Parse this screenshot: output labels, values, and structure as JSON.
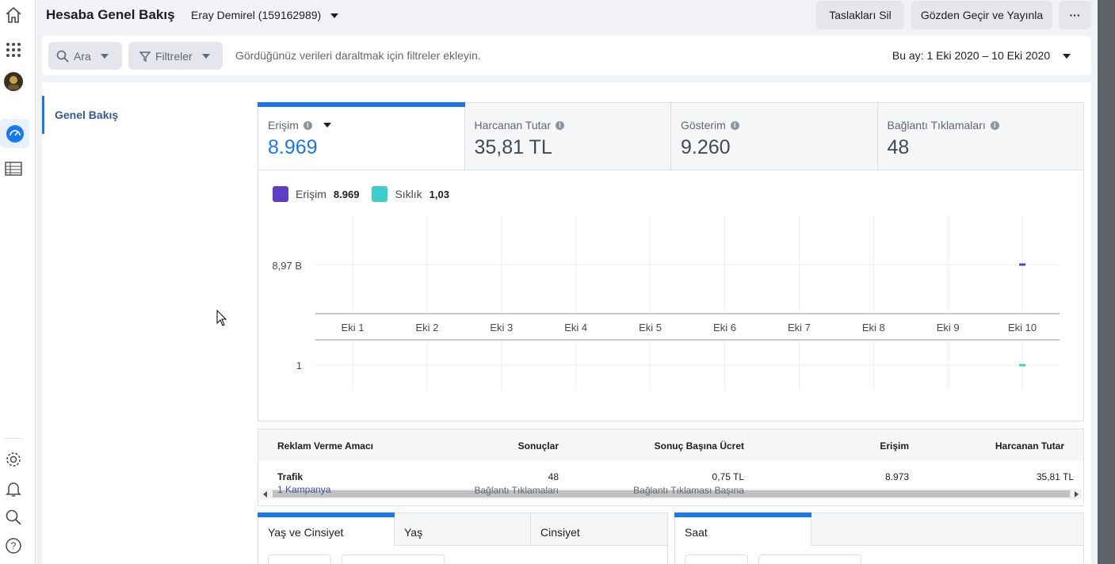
{
  "header": {
    "title": "Hesaba Genel Bakış",
    "account": "Eray Demirel (159162989)",
    "discard_drafts": "Taslakları Sil",
    "review_publish": "Gözden Geçir ve Yayınla",
    "more": "···"
  },
  "filterbar": {
    "search": "Ara",
    "filters": "Filtreler",
    "hint": "Gördüğünüz verileri daraltmak için filtreler ekleyin.",
    "date_range": "Bu ay: 1 Eki 2020 – 10 Eki 2020"
  },
  "nav": {
    "overview": "Genel Bakış"
  },
  "metrics": [
    {
      "label": "Erişim",
      "value": "8.969"
    },
    {
      "label": "Harcanan Tutar",
      "value": "35,81 TL"
    },
    {
      "label": "Gösterim",
      "value": "9.260"
    },
    {
      "label": "Bağlantı Tıklamaları",
      "value": "48"
    }
  ],
  "legend": [
    {
      "name": "Erişim",
      "value": "8.969",
      "color": "#5c3fc4"
    },
    {
      "name": "Sıklık",
      "value": "1,03",
      "color": "#3bcfcc"
    }
  ],
  "chart_data": {
    "type": "line",
    "categories": [
      "Eki 1",
      "Eki 2",
      "Eki 3",
      "Eki 4",
      "Eki 5",
      "Eki 6",
      "Eki 7",
      "Eki 8",
      "Eki 9",
      "Eki 10"
    ],
    "series": [
      {
        "name": "Erişim",
        "values": [
          null,
          null,
          null,
          null,
          null,
          null,
          null,
          null,
          null,
          8969
        ],
        "color": "#5c3fc4"
      },
      {
        "name": "Sıklık",
        "values": [
          null,
          null,
          null,
          null,
          null,
          null,
          null,
          null,
          null,
          1.03
        ],
        "color": "#3bcfcc"
      }
    ],
    "y_top_label": "8,97 B",
    "y_bottom_label": "1",
    "grid": true
  },
  "table": {
    "headers": [
      "Reklam Verme Amacı",
      "Sonuçlar",
      "Sonuç Başına Ücret",
      "Erişim",
      "Harcanan Tutar"
    ],
    "row": {
      "objective": "Trafik",
      "campaigns": "1 Kampanya",
      "results": "48",
      "results_sub": "Bağlantı Tıklamaları",
      "cost": "0,75 TL",
      "cost_sub": "Bağlantı Tıklaması Başına",
      "reach": "8.973",
      "spend": "35,81 TL"
    }
  },
  "bottom_tabs_left": [
    "Yaş ve Cinsiyet",
    "Yaş",
    "Cinsiyet"
  ],
  "bottom_tabs_right": [
    "Saat"
  ],
  "colors": {
    "accent": "#1877f2",
    "link": "#385898"
  }
}
